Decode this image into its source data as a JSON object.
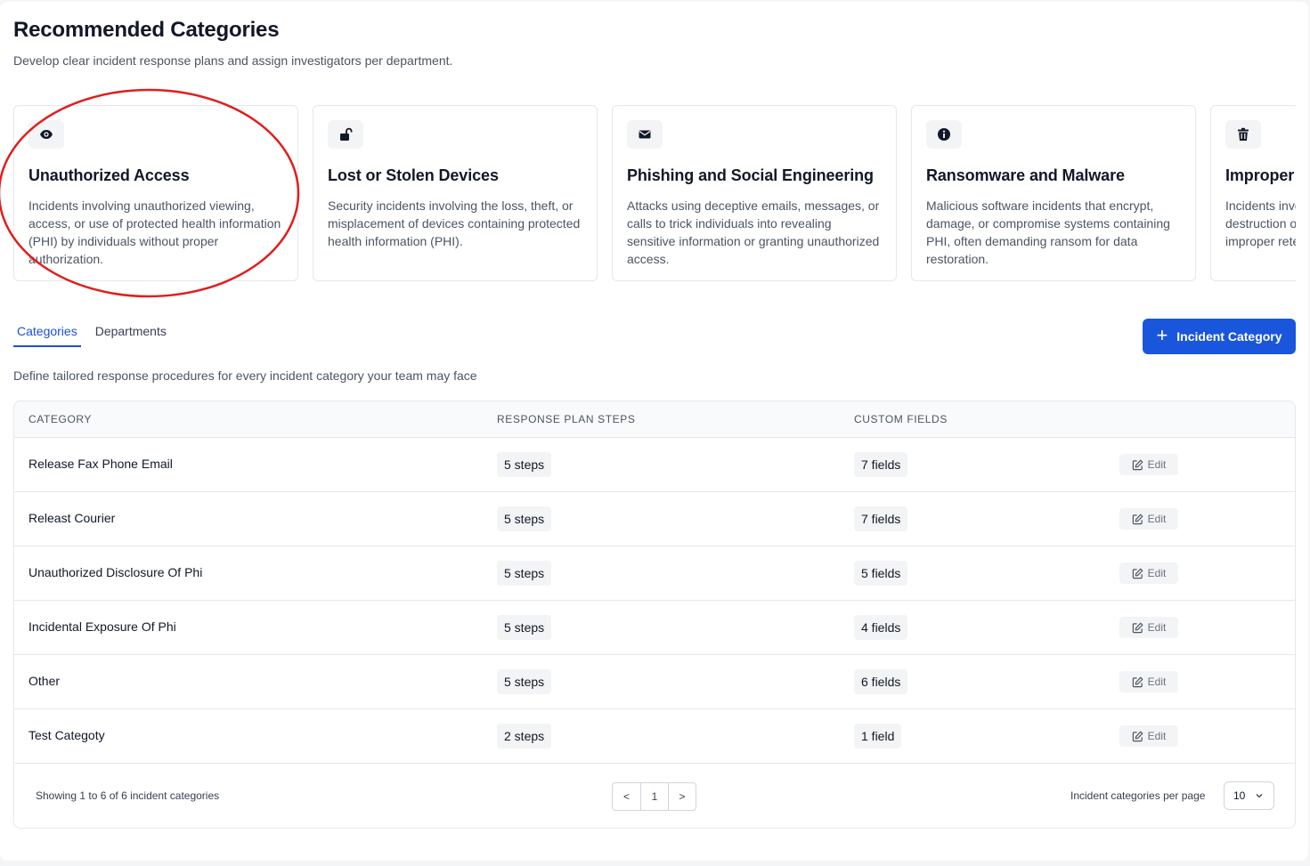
{
  "header": {
    "title": "Recommended Categories",
    "subtitle": "Develop clear incident response plans and assign investigators per department."
  },
  "cards": [
    {
      "icon": "eye-icon",
      "title": "Unauthorized Access",
      "description": "Incidents involving unauthorized viewing, access, or use of protected health information (PHI) by individuals without proper authorization."
    },
    {
      "icon": "unlock-icon",
      "title": "Lost or Stolen Devices",
      "description": "Security incidents involving the loss, theft, or misplacement of devices containing protected health information (PHI)."
    },
    {
      "icon": "envelope-icon",
      "title": "Phishing and Social Engineering",
      "description": "Attacks using deceptive emails, messages, or calls to trick individuals into revealing sensitive information or granting unauthorized access."
    },
    {
      "icon": "info-icon",
      "title": "Ransomware and Malware",
      "description": "Malicious software incidents that encrypt, damage, or compromise systems containing PHI, often demanding ransom for data restoration."
    },
    {
      "icon": "trash-icon",
      "title": "Improper Disposal",
      "description": "Incidents involving improper disposal or destruction of paper or electronic media, or improper retention or"
    }
  ],
  "tabs": [
    {
      "label": "Categories",
      "active": true
    },
    {
      "label": "Departments",
      "active": false
    }
  ],
  "add_button": {
    "label": "Incident Category"
  },
  "section_description": "Define tailored response procedures for every incident category your team may face",
  "table": {
    "columns": [
      "CATEGORY",
      "RESPONSE PLAN STEPS",
      "CUSTOM FIELDS"
    ],
    "edit_label": "Edit",
    "rows": [
      {
        "category": "Release Fax Phone Email",
        "steps": "5 steps",
        "fields": "7 fields"
      },
      {
        "category": "Releast Courier",
        "steps": "5 steps",
        "fields": "7 fields"
      },
      {
        "category": "Unauthorized Disclosure Of Phi",
        "steps": "5 steps",
        "fields": "5 fields"
      },
      {
        "category": "Incidental Exposure Of Phi",
        "steps": "5 steps",
        "fields": "4 fields"
      },
      {
        "category": "Other",
        "steps": "5 steps",
        "fields": "6 fields"
      },
      {
        "category": "Test Categoty",
        "steps": "2 steps",
        "fields": "1 field"
      }
    ]
  },
  "footer": {
    "showing": "Showing 1 to 6 of 6 incident categories",
    "pagination": {
      "prev": "<",
      "page": "1",
      "next": ">"
    },
    "per_page_label": "Incident categories per page",
    "per_page_value": "10"
  },
  "colors": {
    "accent": "#1a56db",
    "annotation": "#e11d1d"
  }
}
